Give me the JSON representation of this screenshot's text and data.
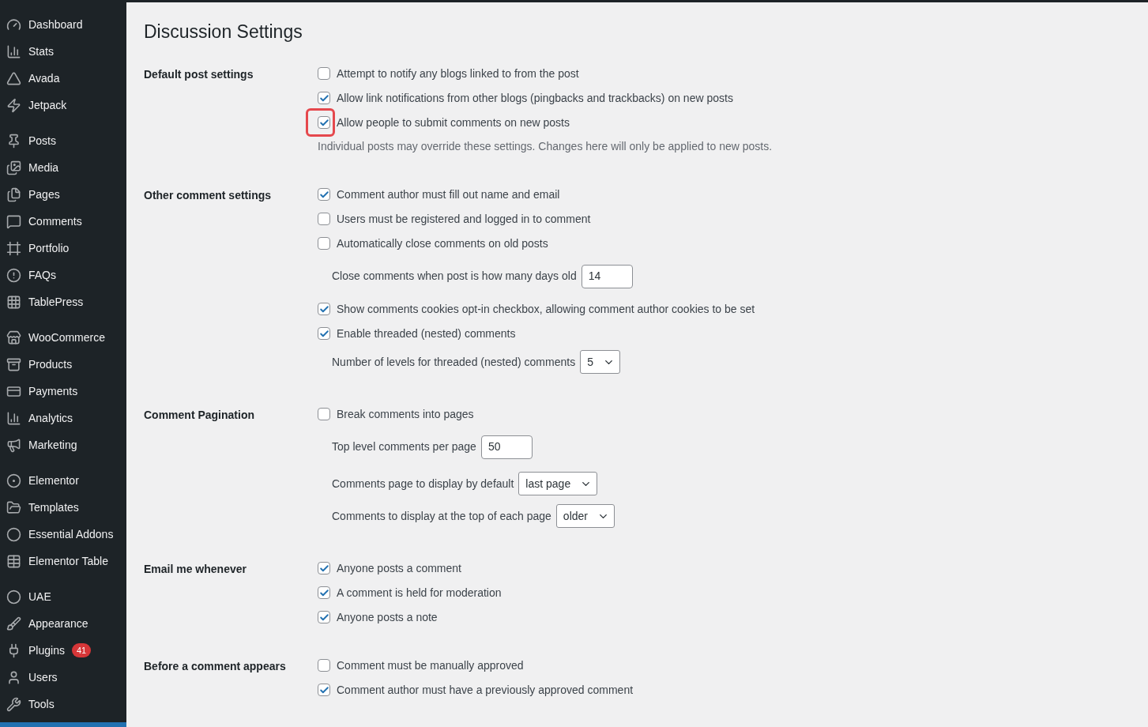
{
  "sidebar": {
    "groups": [
      {
        "items": [
          {
            "label": "Dashboard"
          },
          {
            "label": "Stats"
          },
          {
            "label": "Avada"
          },
          {
            "label": "Jetpack"
          }
        ]
      },
      {
        "items": [
          {
            "label": "Posts"
          },
          {
            "label": "Media"
          },
          {
            "label": "Pages"
          },
          {
            "label": "Comments"
          },
          {
            "label": "Portfolio"
          },
          {
            "label": "FAQs"
          },
          {
            "label": "TablePress"
          }
        ]
      },
      {
        "items": [
          {
            "label": "WooCommerce"
          },
          {
            "label": "Products"
          },
          {
            "label": "Payments"
          },
          {
            "label": "Analytics"
          },
          {
            "label": "Marketing"
          }
        ]
      },
      {
        "items": [
          {
            "label": "Elementor"
          },
          {
            "label": "Templates"
          },
          {
            "label": "Essential Addons"
          },
          {
            "label": "Elementor Table"
          }
        ]
      },
      {
        "items": [
          {
            "label": "UAE"
          },
          {
            "label": "Appearance"
          },
          {
            "label": "Plugins",
            "badge": "41"
          },
          {
            "label": "Users"
          },
          {
            "label": "Tools"
          }
        ]
      }
    ]
  },
  "page": {
    "title": "Discussion Settings",
    "sections": [
      {
        "label": "Default post settings",
        "rows": [
          {
            "kind": "checkbox",
            "label": "Attempt to notify any blogs linked to from the post",
            "checked": false,
            "highlighted": false
          },
          {
            "kind": "checkbox",
            "label": "Allow link notifications from other blogs (pingbacks and trackbacks) on new posts",
            "checked": true,
            "highlighted": false
          },
          {
            "kind": "checkbox",
            "label": "Allow people to submit comments on new posts",
            "checked": true,
            "highlighted": true
          },
          {
            "kind": "note",
            "label": "Individual posts may override these settings. Changes here will only be applied to new posts."
          }
        ]
      },
      {
        "label": "Other comment settings",
        "rows": [
          {
            "kind": "checkbox",
            "label": "Comment author must fill out name and email",
            "checked": true,
            "highlighted": false
          },
          {
            "kind": "checkbox",
            "label": "Users must be registered and logged in to comment",
            "checked": false,
            "highlighted": false
          },
          {
            "kind": "checkbox",
            "label": "Automatically close comments on old posts",
            "checked": false,
            "highlighted": false
          },
          {
            "kind": "field",
            "label": "Close comments when post is how many days old",
            "value": "14"
          },
          {
            "kind": "checkbox",
            "label": "Show comments cookies opt-in checkbox, allowing comment author cookies to be set",
            "checked": true,
            "highlighted": false
          },
          {
            "kind": "checkbox",
            "label": "Enable threaded (nested) comments",
            "checked": true,
            "highlighted": false
          },
          {
            "kind": "select",
            "label": "Number of levels for threaded (nested) comments",
            "value": "5"
          }
        ]
      },
      {
        "label": "Comment Pagination",
        "rows": [
          {
            "kind": "checkbox",
            "label": "Break comments into pages",
            "checked": false,
            "highlighted": false
          },
          {
            "kind": "field",
            "label": "Top level comments per page",
            "value": "50"
          },
          {
            "kind": "select",
            "label": "Comments page to display by default",
            "value": "last page"
          },
          {
            "kind": "select",
            "label": "Comments to display at the top of each page",
            "value": "older"
          }
        ]
      },
      {
        "label": "Email me whenever",
        "rows": [
          {
            "kind": "checkbox",
            "label": "Anyone posts a comment",
            "checked": true,
            "highlighted": false
          },
          {
            "kind": "checkbox",
            "label": "A comment is held for moderation",
            "checked": true,
            "highlighted": false
          },
          {
            "kind": "checkbox",
            "label": "Anyone posts a note",
            "checked": true,
            "highlighted": false
          }
        ]
      },
      {
        "label": "Before a comment appears",
        "rows": [
          {
            "kind": "checkbox",
            "label": "Comment must be manually approved",
            "checked": false,
            "highlighted": false
          },
          {
            "kind": "checkbox",
            "label": "Comment author must have a previously approved comment",
            "checked": true,
            "highlighted": false
          }
        ]
      }
    ]
  }
}
